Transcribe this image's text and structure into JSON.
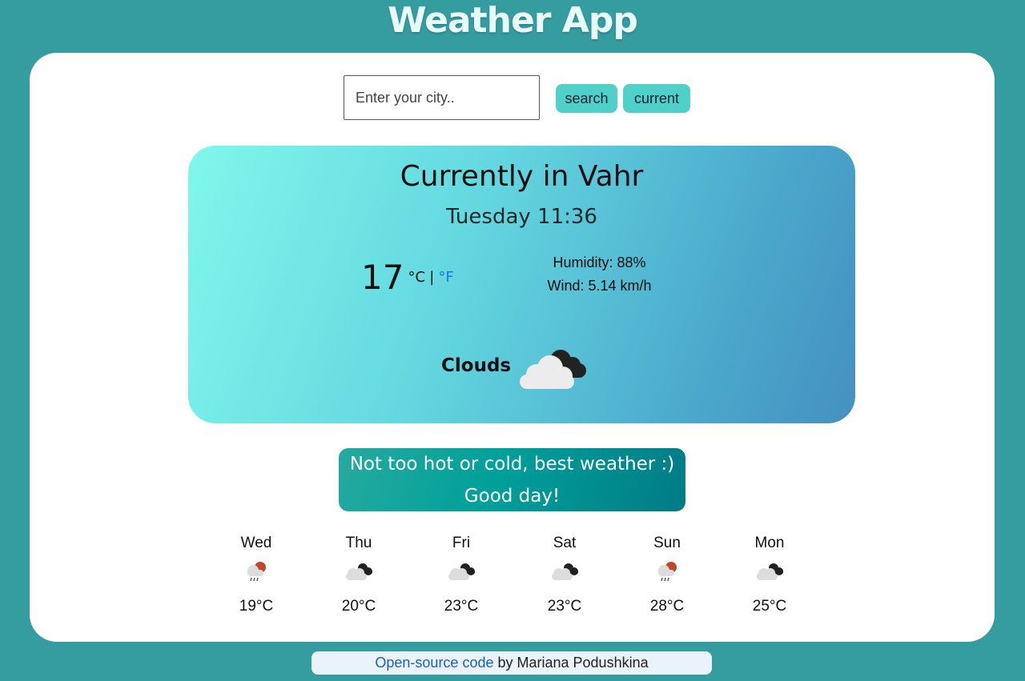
{
  "app": {
    "title": "Weather App"
  },
  "search": {
    "placeholder": "Enter your city..",
    "search_label": "search",
    "current_label": "current"
  },
  "current": {
    "heading": "Currently in Vahr",
    "datetime": "Tuesday 11:36",
    "temperature": "17",
    "unit_c": "°C",
    "unit_sep": "|",
    "unit_f": "°F",
    "humidity": "Humidity: 88%",
    "wind": "Wind: 5.14 km/h",
    "condition": "Clouds",
    "icon": "broken-clouds-icon"
  },
  "message": {
    "line1": "Not too hot or cold, best weather :)",
    "line2": "Good day!"
  },
  "forecast": [
    {
      "day": "Wed",
      "icon": "rain-sun-icon",
      "temp": "19°C"
    },
    {
      "day": "Thu",
      "icon": "clouds-icon",
      "temp": "20°C"
    },
    {
      "day": "Fri",
      "icon": "clouds-icon",
      "temp": "23°C"
    },
    {
      "day": "Sat",
      "icon": "clouds-icon",
      "temp": "23°C"
    },
    {
      "day": "Sun",
      "icon": "rain-sun-icon",
      "temp": "28°C"
    },
    {
      "day": "Mon",
      "icon": "clouds-icon",
      "temp": "25°C"
    }
  ],
  "footer": {
    "link_text": "Open-source code",
    "author_text": " by Mariana Podushkina"
  },
  "colors": {
    "accent": "#4fd0c9",
    "background": "#359c9f",
    "link": "#1a5fc8"
  }
}
